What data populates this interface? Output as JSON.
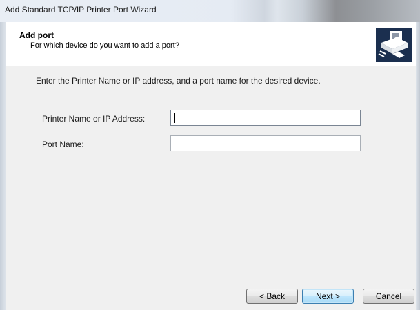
{
  "window": {
    "title": "Add Standard TCP/IP Printer Port Wizard"
  },
  "header": {
    "heading": "Add port",
    "subheading": "For which device do you want to add a port?",
    "icon": "printer-port-icon"
  },
  "body": {
    "instructions": "Enter the Printer Name or IP address, and a port name for the desired device.",
    "fields": {
      "printer_name": {
        "label": "Printer Name or IP Address:",
        "value": ""
      },
      "port_name": {
        "label": "Port Name:",
        "value": ""
      }
    }
  },
  "buttons": {
    "back": "< Back",
    "next": "Next >",
    "cancel": "Cancel"
  },
  "colors": {
    "header_bg": "#ffffff",
    "body_bg": "#f0f0f0",
    "icon_bg": "#1b2f4f",
    "default_button_border": "#3c7fb1"
  }
}
